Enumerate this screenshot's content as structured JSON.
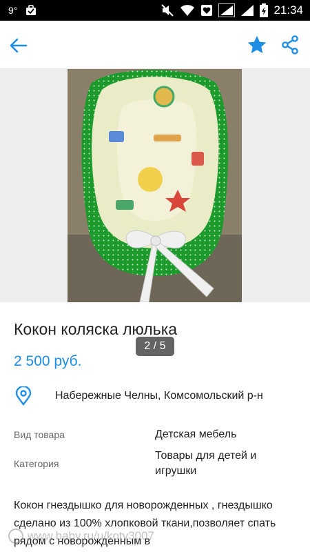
{
  "status_bar": {
    "temperature": "9°",
    "time": "21:34"
  },
  "toolbar": {
    "back_icon": "arrow-left-icon",
    "favorite_icon": "star-icon",
    "share_icon": "share-icon",
    "accent_color": "#1d8ee6"
  },
  "gallery": {
    "counter": "2 / 5"
  },
  "listing": {
    "title": "Кокон коляска люлька",
    "price": "2 500 руб.",
    "location": "Набережные Челны, Комсомольский р-н",
    "properties": [
      {
        "label": "Вид товара",
        "value": "Детская мебель"
      },
      {
        "label": "Категория",
        "value": "Товары для детей и игрушки"
      }
    ],
    "description": "Кокон гнездышко  для новорожденных , гнездышко сделано из 100% хлопковой ткани,позволяет спать рядом с новорожденным  в"
  },
  "watermark": {
    "text": "www.baby.ru/u/koty3007"
  }
}
